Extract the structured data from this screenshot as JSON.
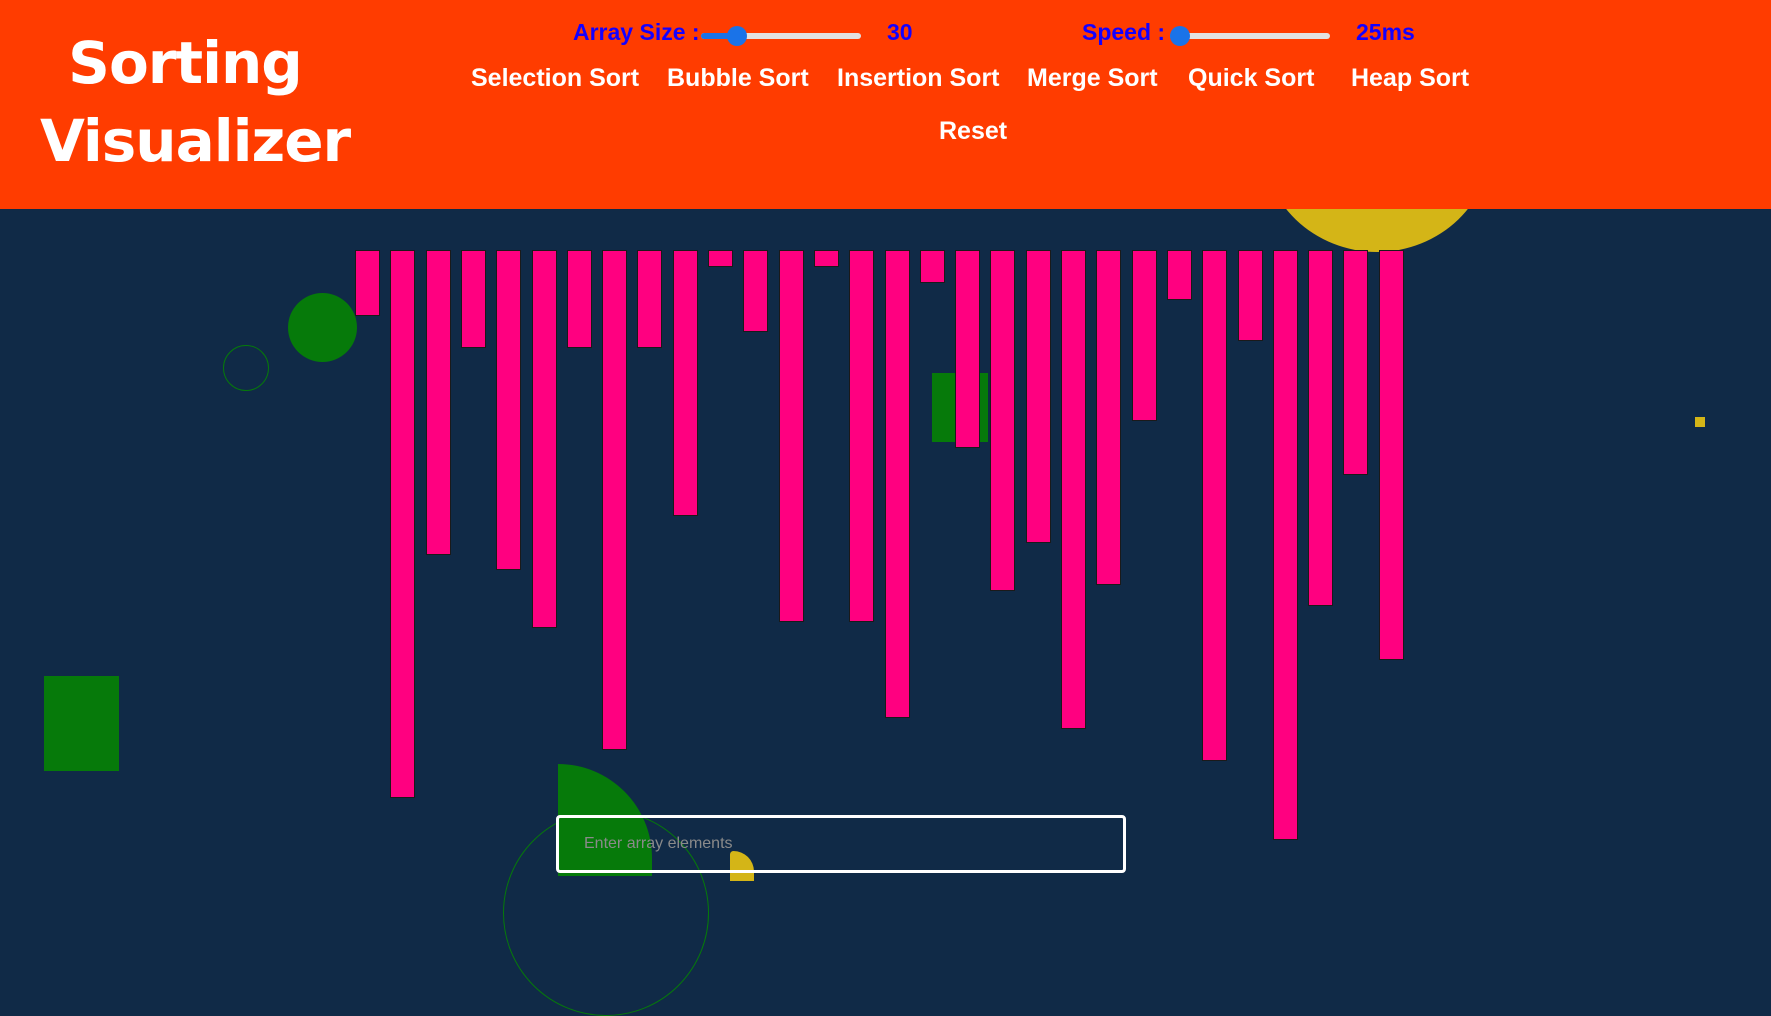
{
  "header": {
    "title_line1": "Sorting",
    "title_line2": "Visualizer",
    "array_size_label": "Array Size :",
    "array_size_value": "30",
    "speed_label": "Speed :",
    "speed_value": "25ms",
    "algorithms": [
      "Selection Sort",
      "Bubble Sort",
      "Insertion Sort",
      "Merge Sort",
      "Quick Sort",
      "Heap Sort"
    ],
    "reset_label": "Reset"
  },
  "array": {
    "size": 30,
    "values": [
      66,
      548,
      305,
      98,
      320,
      378,
      98,
      500,
      98,
      266,
      17,
      82,
      372,
      17,
      372,
      468,
      33,
      198,
      341,
      293,
      479,
      335,
      171,
      50,
      511,
      91,
      590,
      356,
      225,
      410
    ]
  },
  "input": {
    "placeholder": "Enter array elements"
  },
  "colors": {
    "header_bg": "#ff3c00",
    "background": "#102a47",
    "bar": "#ff0080",
    "label_blue": "#1400ff",
    "deco_green": "#067a0a",
    "deco_yellow": "#d4b517"
  }
}
